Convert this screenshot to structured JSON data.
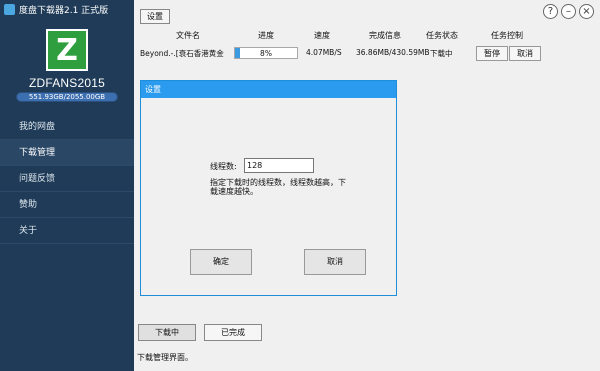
{
  "app": {
    "title": "度盘下载器2.1 正式版"
  },
  "sidebar": {
    "logo_letter": "Z",
    "username": "ZDFANS2015",
    "quota": "551.93GB/2055.00GB",
    "items": [
      {
        "label": "我的网盘"
      },
      {
        "label": "下载管理"
      },
      {
        "label": "问题反馈"
      },
      {
        "label": "赞助"
      },
      {
        "label": "关于"
      }
    ]
  },
  "toolbar": {
    "settings_label": "设置"
  },
  "window_controls": {
    "help": "?",
    "minimize": "–",
    "close": "×"
  },
  "table": {
    "headers": [
      "文件名",
      "进度",
      "速度",
      "完成信息",
      "任务状态",
      "任务控制"
    ],
    "rows": [
      {
        "filename": "Beyond.-.[衰石香港黄金",
        "progress": 8,
        "progress_label": "8%",
        "speed": "4.07MB/S",
        "done": "36.86MB/430.59MB",
        "status": "下载中",
        "pause_label": "暂停",
        "cancel_label": "取消"
      }
    ]
  },
  "dialog": {
    "title": "设置",
    "thread_label": "线程数:",
    "thread_value": "128",
    "note": "指定下载时的线程数，线程数越高，下载速度越快。",
    "ok_label": "确定",
    "cancel_label": "取消"
  },
  "tabs": {
    "downloading": "下载中",
    "completed": "已完成"
  },
  "status_text": "下载管理界面。",
  "colors": {
    "sidebar": "#1f3b57",
    "accent": "#2a9bee",
    "logo": "#2e9e3e"
  }
}
